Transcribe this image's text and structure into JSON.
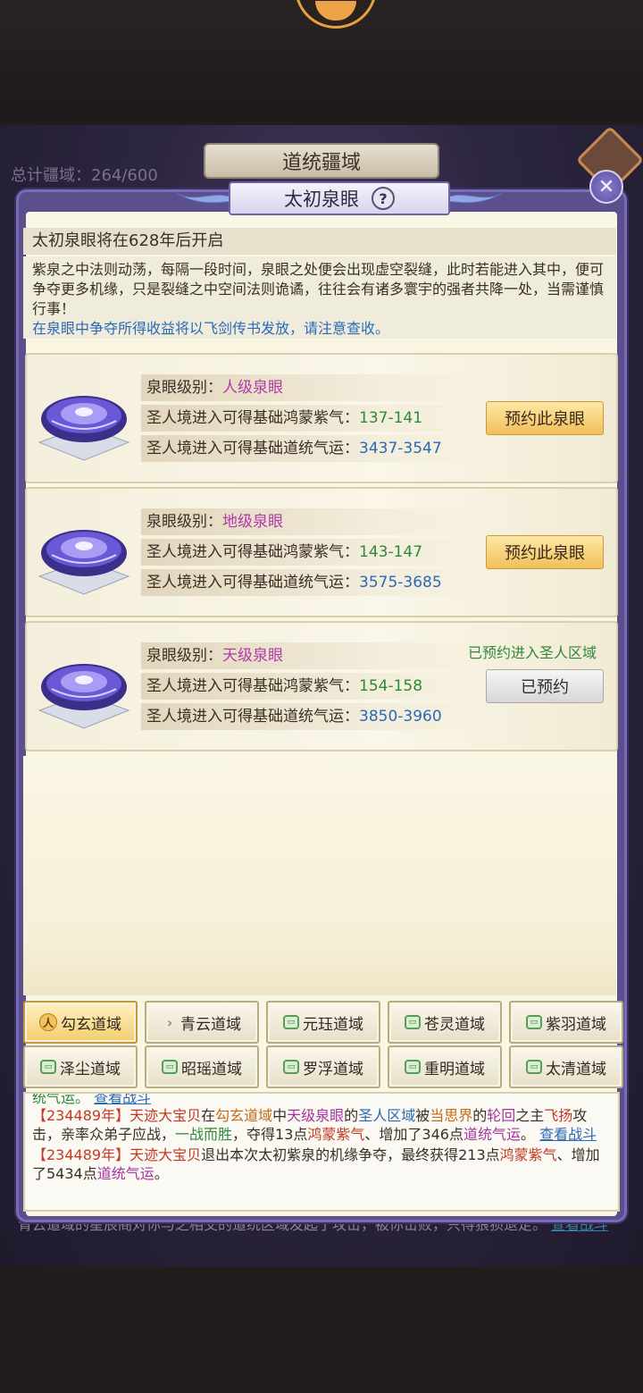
{
  "background": {
    "window_title": "道统疆域",
    "total_label": "总计疆域：264/600",
    "bottom_text": "青云道域的星辰阁对你与之相交的道统区域发起了攻击，被你击败，只得狼狈退走。",
    "bottom_link": "查看战斗"
  },
  "dialog": {
    "title": "太初泉眼",
    "help": "?",
    "close": "✕",
    "open_banner": "太初泉眼将在628年后开启",
    "description": "紫泉之中法则动荡，每隔一段时间，泉眼之处便会出现虚空裂缝，此时若能进入其中，便可争夺更多机缘，只是裂缝之中空间法则诡谲，往往会有诸多寰宇的强者共降一处，当需谨慎行事！",
    "notice": "在泉眼中争夺所得收益将以飞剑传书发放，请注意查收。"
  },
  "eyes": [
    {
      "grade_label": "泉眼级别：",
      "grade": "人级泉眼",
      "qi_label": "圣人境进入可得基础鸿蒙紫气：",
      "qi": "137-141",
      "luck_label": "圣人境进入可得基础道统气运：",
      "luck": "3437-3547",
      "button": "预约此泉眼",
      "booked": false,
      "booked_note": ""
    },
    {
      "grade_label": "泉眼级别：",
      "grade": "地级泉眼",
      "qi_label": "圣人境进入可得基础鸿蒙紫气：",
      "qi": "143-147",
      "luck_label": "圣人境进入可得基础道统气运：",
      "luck": "3575-3685",
      "button": "预约此泉眼",
      "booked": false,
      "booked_note": ""
    },
    {
      "grade_label": "泉眼级别：",
      "grade": "天级泉眼",
      "qi_label": "圣人境进入可得基础鸿蒙紫气：",
      "qi": "154-158",
      "luck_label": "圣人境进入可得基础道统气运：",
      "luck": "3850-3960",
      "button": "已预约",
      "booked": true,
      "booked_note": "已预约进入圣人区域"
    }
  ],
  "domains": [
    {
      "label": "勾玄道域",
      "icon": "person-icon",
      "active": true
    },
    {
      "label": "青云道域",
      "icon": "chevron-icon",
      "active": false
    },
    {
      "label": "元珏道域",
      "icon": "lock-icon",
      "active": false
    },
    {
      "label": "苍灵道域",
      "icon": "lock-icon",
      "active": false
    },
    {
      "label": "紫羽道域",
      "icon": "lock-icon",
      "active": false
    },
    {
      "label": "泽尘道域",
      "icon": "lock-icon",
      "active": false
    },
    {
      "label": "昭瑶道域",
      "icon": "lock-icon",
      "active": false
    },
    {
      "label": "罗浮道域",
      "icon": "lock-icon",
      "active": false
    },
    {
      "label": "重明道域",
      "icon": "lock-icon",
      "active": false
    },
    {
      "label": "太清道域",
      "icon": "lock-icon",
      "active": false
    }
  ],
  "log": {
    "cut_line": "统气运。",
    "cut_link": "查看战斗",
    "entry1": {
      "year": "【234489年】",
      "name": "天迹大宝贝",
      "t1": "在",
      "domain": "勾玄道域",
      "t2": "中",
      "grade": "天级泉眼",
      "t3": "的",
      "area": "圣人区域",
      "t4": "被",
      "realm": "当思界",
      "t5": "的",
      "sect": "轮回",
      "t6": "之主",
      "attacker": "飞扬",
      "t7": "攻击，亲率众弟子应战，",
      "win": "一战而胜",
      "t8": "，夺得13点",
      "qi_name": "鸿蒙紫气",
      "t9": "、增加了346点",
      "luck_name": "道统气运",
      "t10": "。",
      "link": "查看战斗"
    },
    "entry2": {
      "year": "【234489年】",
      "name": "天迹大宝贝",
      "t1": "退出本次太初紫泉的机缘争夺，最终获得213点",
      "qi_name": "鸿蒙紫气",
      "t2": "、增加了5434点",
      "luck_name": "道统气运",
      "t3": "。"
    }
  },
  "colors": {
    "grade": "#b03aa8",
    "qi": "#2d8a3a",
    "luck": "#2a69b8",
    "year": "#c23a26",
    "frame": "#5b4f8e"
  }
}
